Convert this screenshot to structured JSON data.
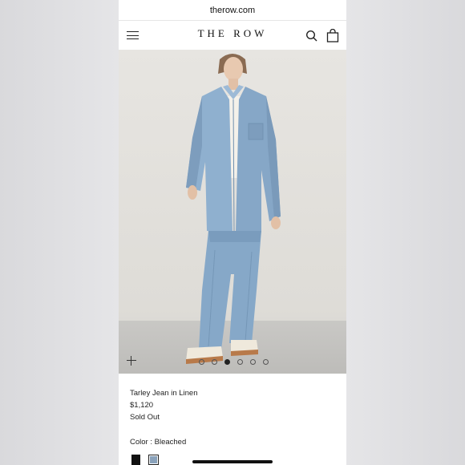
{
  "browser": {
    "url": "therow.com"
  },
  "header": {
    "brand": "THE ROW",
    "menu_icon": "hamburger-menu-icon",
    "search_icon": "search-icon",
    "bag_icon": "shopping-bag-icon"
  },
  "gallery": {
    "zoom_icon": "plus-icon",
    "total_images": 6,
    "active_index": 3
  },
  "product": {
    "name": "Tarley Jean in Linen",
    "price": "$1,120",
    "availability": "Sold Out",
    "color_label": "Color : Bleached",
    "swatches": [
      {
        "color": "#111111",
        "selected": false
      },
      {
        "color": "#8aa2bb",
        "selected": true
      }
    ]
  }
}
